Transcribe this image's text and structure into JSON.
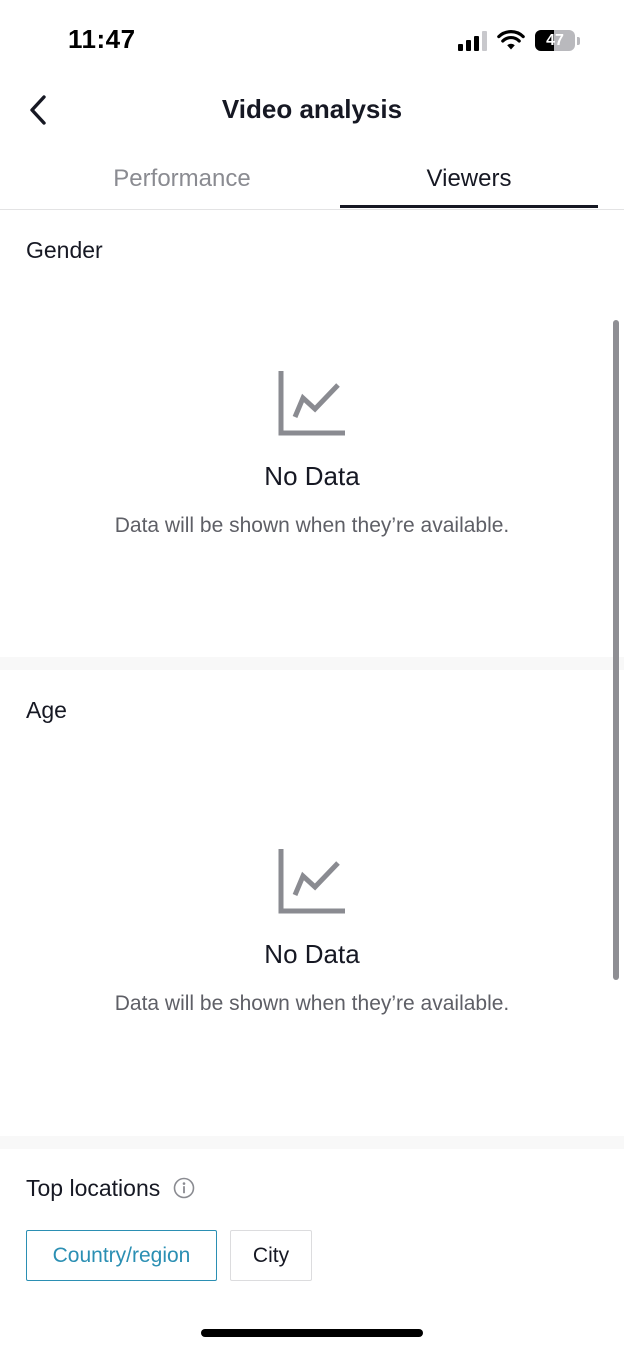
{
  "status_bar": {
    "time": "11:47",
    "battery_level": "47",
    "icons": [
      "cellular-signal-icon",
      "wifi-icon",
      "battery-icon"
    ]
  },
  "header": {
    "title": "Video analysis",
    "back_icon": "chevron-left-icon"
  },
  "tabs": [
    {
      "label": "Performance",
      "active": false
    },
    {
      "label": "Viewers",
      "active": true
    }
  ],
  "sections": {
    "gender": {
      "title": "Gender",
      "empty_icon": "line-chart-icon",
      "empty_title": "No Data",
      "empty_text": "Data will be shown when they’re available."
    },
    "age": {
      "title": "Age",
      "empty_icon": "line-chart-icon",
      "empty_title": "No Data",
      "empty_text": "Data will be shown when they’re available."
    },
    "top_locations": {
      "title": "Top locations",
      "info_icon": "info-icon",
      "filters": [
        {
          "label": "Country/region",
          "selected": true
        },
        {
          "label": "City",
          "selected": false
        }
      ]
    }
  },
  "colors": {
    "text_primary": "#161823",
    "text_secondary": "#8a8b91",
    "accent": "#2b8fb3",
    "chart_icon": "#8a8b91",
    "section_divider": "#f8f8f8"
  }
}
